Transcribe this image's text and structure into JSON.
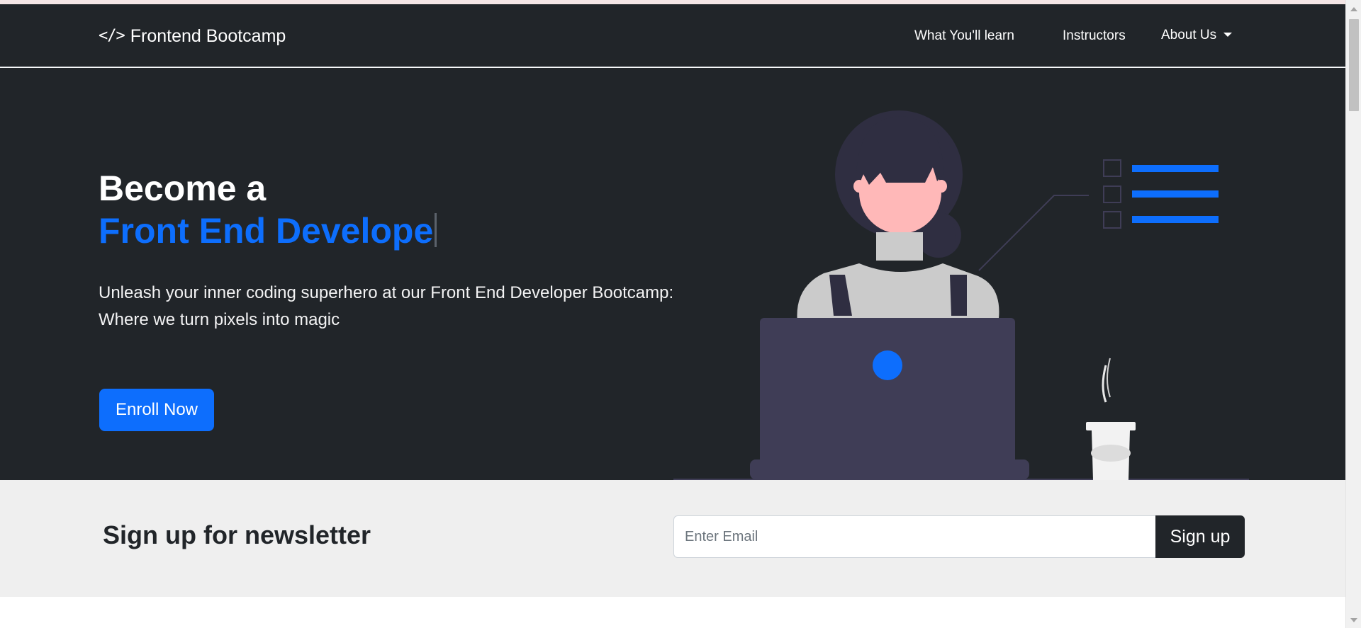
{
  "navbar": {
    "brand_icon": "</>",
    "brand_text": "Frontend Bootcamp",
    "links": [
      {
        "label": "What You'll learn"
      },
      {
        "label": "Instructors"
      },
      {
        "label": "About Us"
      }
    ]
  },
  "hero": {
    "title_line1": "Become a",
    "title_line2_typed": "Front End Develope",
    "description": "Unleash your inner coding superhero at our Front End Developer Bootcamp: Where we turn pixels into magic",
    "cta_label": "Enroll Now"
  },
  "newsletter": {
    "title": "Sign up for newsletter",
    "email_placeholder": "Enter Email",
    "email_value": "",
    "button_label": "Sign up"
  },
  "colors": {
    "dark": "#212529",
    "primary": "#0d6efd",
    "light_section": "#efefef"
  },
  "icons": [
    "code-icon",
    "caret-down-icon",
    "person-at-laptop-illustration"
  ]
}
